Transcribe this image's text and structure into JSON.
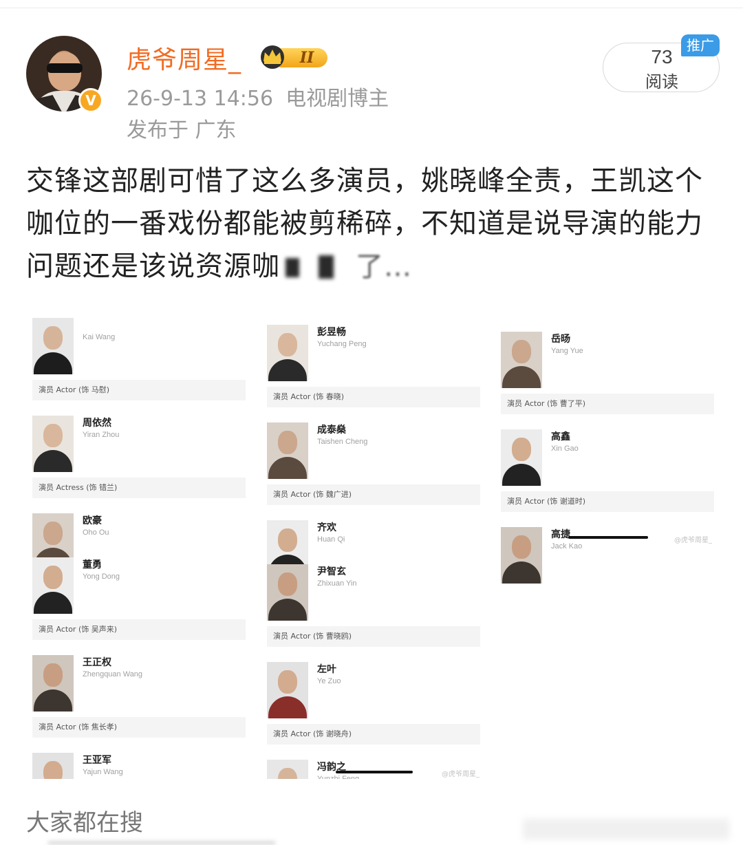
{
  "post": {
    "username": "虎爷周星_",
    "level_badge": "II",
    "timestamp": "26-9-13 14:56",
    "author_tag": "电视剧博主",
    "location": "发布于 广东",
    "read_count": "73",
    "read_label": "阅读",
    "promo_tag": "推广",
    "verified_mark": "V",
    "text": "交锋这部剧可惜了这么多演员，姚晓峰全责，王凯这个咖位的一番戏份都能被剪稀碎，不知道是说导演的能力问题还是该说资源咖"
  },
  "cast_image": {
    "columns": [
      {
        "cards": [
          {
            "name": "",
            "en": "Kai Wang",
            "role": "演员 Actor (饰 马慰)"
          },
          {
            "name": "周依然",
            "en": "Yiran Zhou",
            "role": "演员 Actress (饰 错兰)"
          },
          {
            "name": "欧豪",
            "en": "Oho Ou",
            "role": ""
          },
          {
            "name": "董勇",
            "en": "Yong Dong",
            "role": "演员 Actor (饰 吴声来)"
          },
          {
            "name": "王正权",
            "en": "Zhengquan Wang",
            "role": "演员 Actor (饰 焦长孝)"
          },
          {
            "name": "王亚军",
            "en": "Yajun Wang",
            "role": ""
          }
        ]
      },
      {
        "cards": [
          {
            "name": "彭昱畅",
            "en": "Yuchang Peng",
            "role": "演员 Actor (饰 春晓)"
          },
          {
            "name": "成泰燊",
            "en": "Taishen Cheng",
            "role": "演员 Actor (饰 魏广进)"
          },
          {
            "name": "齐欢",
            "en": "Huan Qi",
            "role": ""
          },
          {
            "name": "尹智玄",
            "en": "Zhixuan Yin",
            "role": "演员 Actor (饰 曹晓鸥)"
          },
          {
            "name": "左叶",
            "en": "Ye Zuo",
            "role": "演员 Actor (饰 谢晓舟)"
          },
          {
            "name": "冯韵之",
            "en": "Yunzhi Feng",
            "role": ""
          }
        ]
      },
      {
        "cards": [
          {
            "name": "岳旸",
            "en": "Yang Yue",
            "role": "演员 Actor (饰 曹了平)"
          },
          {
            "name": "高鑫",
            "en": "Xin Gao",
            "role": "演员 Actor (饰 谢道时)"
          },
          {
            "name": "高捷",
            "en": "Jack Kao",
            "role": ""
          }
        ]
      }
    ],
    "watermark": "@虎爷周星_"
  },
  "footer": {
    "trending_title": "大家都在搜"
  }
}
